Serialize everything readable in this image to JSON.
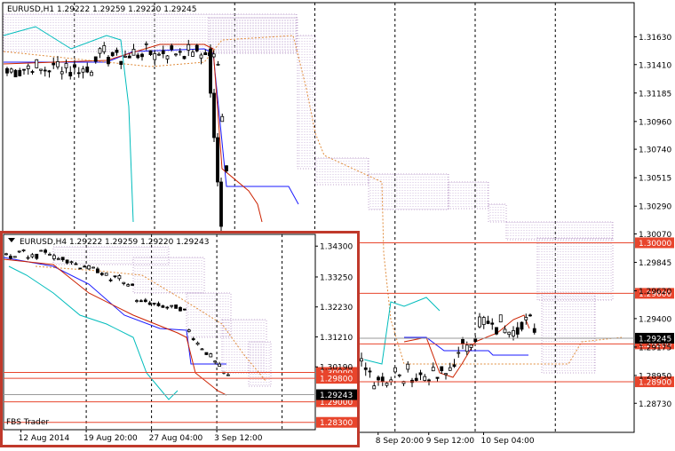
{
  "chart_data": [
    {
      "name": "main",
      "type": "candlestick",
      "symbol_header": "EURUSD,H1  1.29222 1.29259 1.29220 1.29245",
      "ylim": [
        1.285,
        1.319
      ],
      "y_ticks": [
        "1.31630",
        "1.31410",
        "1.31185",
        "1.30960",
        "1.30740",
        "1.30515",
        "1.30290",
        "1.30070",
        "1.29845",
        "1.29620",
        "1.29400",
        "1.29175",
        "1.28950",
        "1.28730"
      ],
      "x_ticks": [
        {
          "label": "p 04:00",
          "index": 76
        },
        {
          "label": "8 Sep 20:00",
          "index": 89
        },
        {
          "label": "9 Sep 12:00",
          "index": 101
        },
        {
          "label": "10 Sep 04:00",
          "index": 114
        }
      ],
      "vgrid_index": [
        17,
        36,
        55,
        74,
        93,
        112,
        131
      ],
      "level_lines": [
        {
          "value": 1.3,
          "label": "1.30000"
        },
        {
          "value": 1.296,
          "label": "1.29600"
        },
        {
          "value": 1.292,
          "label": "1.29200"
        },
        {
          "value": 1.289,
          "label": "1.28900"
        }
      ],
      "current_price": {
        "value": 1.29245,
        "label": "1.29245"
      },
      "colors": {
        "level": "#ff0000",
        "grid": "#000000",
        "kijun": "#0000cc",
        "tenkan": "#cc0000",
        "chikou": "#00bcbc",
        "senkou_a": "#e08c3c",
        "cloud": "#b090c0"
      }
    },
    {
      "name": "inset",
      "type": "candlestick",
      "symbol_header": "EURUSD,H4  1.29222 1.29259 1.29220 1.29243",
      "ylim": [
        1.2805,
        1.347
      ],
      "y_ticks": [
        "1.34300",
        "1.33250",
        "1.32230",
        "1.31210",
        "1.30190"
      ],
      "x_ticks": [
        {
          "label": "12 Aug 2014",
          "index": 4
        },
        {
          "label": "19 Aug 20:00",
          "index": 19
        },
        {
          "label": "27 Aug 04:00",
          "index": 34
        },
        {
          "label": "3 Sep 12:00",
          "index": 49
        }
      ],
      "vgrid_index": [
        19,
        34,
        49,
        64
      ],
      "level_lines": [
        {
          "value": 1.3,
          "label": "1.30000"
        },
        {
          "value": 1.298,
          "label": "1.29800"
        },
        {
          "value": 1.29,
          "label": "1.29000"
        },
        {
          "value": 1.283,
          "label": "1.28300"
        }
      ],
      "current_price": {
        "value": 1.29243,
        "label": "1.29243"
      },
      "watermark": "FBS Trader",
      "colors": {
        "frame": "#c0392b"
      }
    }
  ]
}
